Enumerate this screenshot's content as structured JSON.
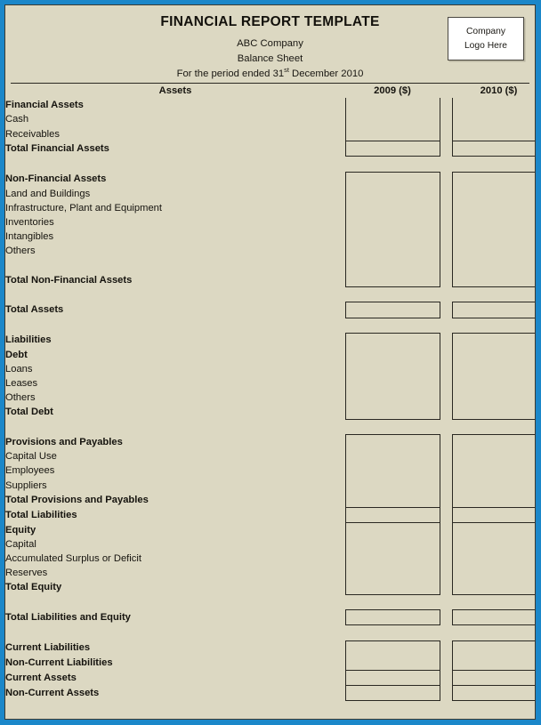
{
  "document": {
    "title": "FINANCIAL REPORT TEMPLATE",
    "company": "ABC Company",
    "statement": "Balance Sheet",
    "period_prefix": "For the period ended 31",
    "period_ordinal": "st",
    "period_suffix": " December 2010"
  },
  "logo": {
    "line1": "Company",
    "line2": "Logo Here"
  },
  "colors": {
    "frame_blue": "#1b87c9",
    "paper_beige": "#dcd8c2",
    "ink": "#15130e",
    "rule": "#2a2822",
    "logo_bg": "#ffffff"
  },
  "table": {
    "section_header": "Assets",
    "col_2009": "2009 ($)",
    "col_2010": "2010 ($)",
    "rows": [
      {
        "label": "Financial Assets",
        "indent": 0,
        "bold": true,
        "value_2009": "",
        "value_2010": ""
      },
      {
        "label": "Cash",
        "indent": 1,
        "bold": false,
        "value_2009": "",
        "value_2010": ""
      },
      {
        "label": "Receivables",
        "indent": 1,
        "bold": false,
        "value_2009": "",
        "value_2010": ""
      },
      {
        "label": "Total Financial Assets",
        "indent": 3,
        "bold": true,
        "value_2009": "",
        "value_2010": ""
      },
      {
        "label": "",
        "indent": 0,
        "bold": false,
        "value_2009": "",
        "value_2010": ""
      },
      {
        "label": "Non-Financial Assets",
        "indent": 0,
        "bold": true,
        "value_2009": "",
        "value_2010": ""
      },
      {
        "label": "Land and Buildings",
        "indent": 1,
        "bold": false,
        "value_2009": "",
        "value_2010": ""
      },
      {
        "label": "Infrastructure, Plant and Equipment",
        "indent": 1,
        "bold": false,
        "value_2009": "",
        "value_2010": ""
      },
      {
        "label": "Inventories",
        "indent": 1,
        "bold": false,
        "value_2009": "",
        "value_2010": ""
      },
      {
        "label": "Intangibles",
        "indent": 1,
        "bold": false,
        "value_2009": "",
        "value_2010": ""
      },
      {
        "label": "Others",
        "indent": 1,
        "bold": false,
        "value_2009": "",
        "value_2010": ""
      },
      {
        "label": "",
        "indent": 0,
        "bold": false,
        "value_2009": "",
        "value_2010": ""
      },
      {
        "label": "Total Non-Financial Assets",
        "indent": 3,
        "bold": true,
        "value_2009": "",
        "value_2010": ""
      },
      {
        "label": "",
        "indent": 0,
        "bold": false,
        "value_2009": "",
        "value_2010": ""
      },
      {
        "label": "Total Assets",
        "indent": 0,
        "bold": true,
        "value_2009": "",
        "value_2010": ""
      },
      {
        "label": "",
        "indent": 0,
        "bold": false,
        "value_2009": "",
        "value_2010": ""
      },
      {
        "label": "Liabilities",
        "indent": 0,
        "bold": true,
        "value_2009": "",
        "value_2010": ""
      },
      {
        "label": "Debt",
        "indent": 3,
        "bold": true,
        "value_2009": "",
        "value_2010": ""
      },
      {
        "label": "Loans",
        "indent": 2,
        "bold": false,
        "value_2009": "",
        "value_2010": ""
      },
      {
        "label": "Leases",
        "indent": 2,
        "bold": false,
        "value_2009": "",
        "value_2010": ""
      },
      {
        "label": "Others",
        "indent": 2,
        "bold": false,
        "value_2009": "",
        "value_2010": ""
      },
      {
        "label": "Total Debt",
        "indent": 3,
        "bold": true,
        "value_2009": "",
        "value_2010": ""
      },
      {
        "label": "",
        "indent": 0,
        "bold": false,
        "value_2009": "",
        "value_2010": ""
      },
      {
        "label": "Provisions and Payables",
        "indent": 0,
        "bold": true,
        "value_2009": "",
        "value_2010": ""
      },
      {
        "label": "Capital Use",
        "indent": 1,
        "bold": false,
        "value_2009": "",
        "value_2010": ""
      },
      {
        "label": "Employees",
        "indent": 1,
        "bold": false,
        "value_2009": "",
        "value_2010": ""
      },
      {
        "label": "Suppliers",
        "indent": 1,
        "bold": false,
        "value_2009": "",
        "value_2010": ""
      },
      {
        "label": "Total Provisions and Payables",
        "indent": 3,
        "bold": true,
        "value_2009": "",
        "value_2010": ""
      },
      {
        "label": "Total Liabilities",
        "indent": 0,
        "bold": true,
        "value_2009": "",
        "value_2010": ""
      },
      {
        "label": "Equity",
        "indent": 0,
        "bold": true,
        "value_2009": "",
        "value_2010": ""
      },
      {
        "label": "Capital",
        "indent": 1,
        "bold": false,
        "value_2009": "",
        "value_2010": ""
      },
      {
        "label": "Accumulated Surplus or Deficit",
        "indent": 1,
        "bold": false,
        "value_2009": "",
        "value_2010": ""
      },
      {
        "label": "Reserves",
        "indent": 1,
        "bold": false,
        "value_2009": "",
        "value_2010": ""
      },
      {
        "label": "Total Equity",
        "indent": 3,
        "bold": true,
        "value_2009": "",
        "value_2010": ""
      },
      {
        "label": "",
        "indent": 0,
        "bold": false,
        "value_2009": "",
        "value_2010": ""
      },
      {
        "label": "Total Liabilities and Equity",
        "indent": 0,
        "bold": true,
        "value_2009": "",
        "value_2010": ""
      },
      {
        "label": "",
        "indent": 0,
        "bold": false,
        "value_2009": "",
        "value_2010": ""
      },
      {
        "label": "Current Liabilities",
        "indent": 0,
        "bold": true,
        "value_2009": "",
        "value_2010": ""
      },
      {
        "label": "Non-Current Liabilities",
        "indent": 0,
        "bold": true,
        "value_2009": "",
        "value_2010": ""
      },
      {
        "label": "Current Assets",
        "indent": 0,
        "bold": true,
        "value_2009": "",
        "value_2010": ""
      },
      {
        "label": "Non-Current Assets",
        "indent": 0,
        "bold": true,
        "value_2009": "",
        "value_2010": ""
      }
    ]
  }
}
